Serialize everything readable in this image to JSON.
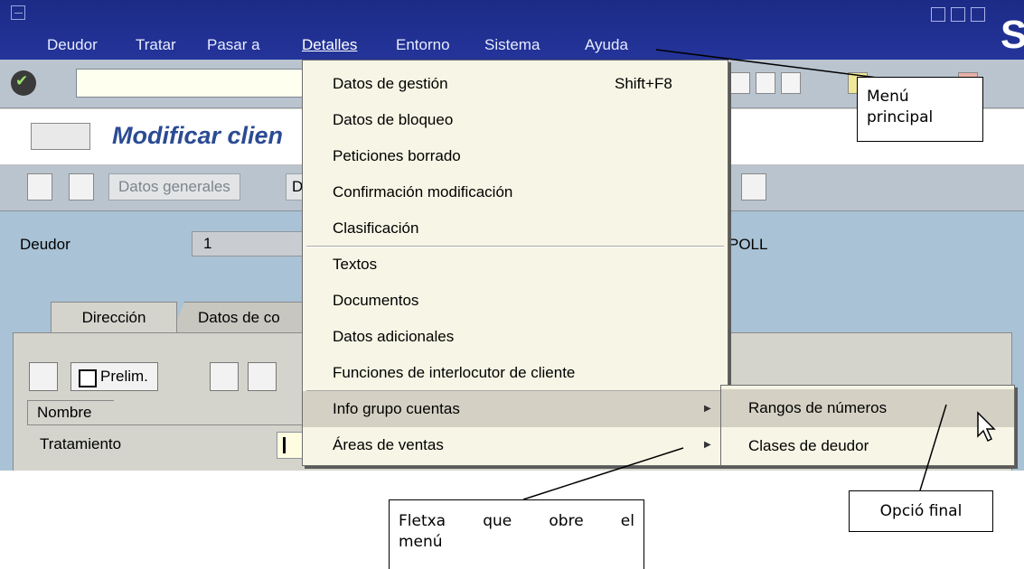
{
  "menubar": {
    "items": [
      "Deudor",
      "Tratar",
      "Pasar a",
      "Detalles",
      "Entorno",
      "Sistema",
      "Ayuda"
    ],
    "active": "Detalles"
  },
  "titlebar": {
    "title": "Modificar clien"
  },
  "app_toolbar": {
    "datos_generales": "Datos generales",
    "partial_button": "D"
  },
  "header": {
    "deudor_label": "Deudor",
    "deudor_value": "1",
    "name_partial": "POLL"
  },
  "tabs": [
    {
      "label": "Dirección",
      "active": true
    },
    {
      "label": "Datos de co",
      "active": false
    }
  ],
  "panel": {
    "prelim_button": "Prelim.",
    "nombre_header": "Nombre",
    "tratamiento_label": "Tratamiento"
  },
  "dropdown": {
    "items": [
      {
        "label": "Datos de gestión",
        "shortcut": "Shift+F8"
      },
      {
        "label": "Datos de bloqueo"
      },
      {
        "label": "Peticiones borrado"
      },
      {
        "label": "Confirmación modificación"
      },
      {
        "label": "Clasificación"
      },
      {
        "label": "Textos"
      },
      {
        "label": "Documentos"
      },
      {
        "label": "Datos adicionales"
      },
      {
        "label": "Funciones de interlocutor de cliente"
      },
      {
        "label": "Info grupo cuentas",
        "submenu": true,
        "highlighted": true
      },
      {
        "label": "Áreas de ventas",
        "submenu": true
      }
    ]
  },
  "submenu": {
    "items": [
      {
        "label": "Rangos de números",
        "highlighted": true
      },
      {
        "label": "Clases de deudor"
      }
    ]
  },
  "annotations": {
    "menu_principal_line1": "Menú",
    "menu_principal_line2": "principal",
    "opcio_final": "Opció final",
    "fletxa_line1": "Fletxa que obre el",
    "fletxa_line2": "menú"
  },
  "colors": {
    "menubar_bg": "#1f2f8e",
    "toolbar_bg": "#b9c4cf",
    "content_bg": "#a9c2d5",
    "dropdown_bg": "#f7f6e6",
    "title_color": "#2b4b93"
  }
}
